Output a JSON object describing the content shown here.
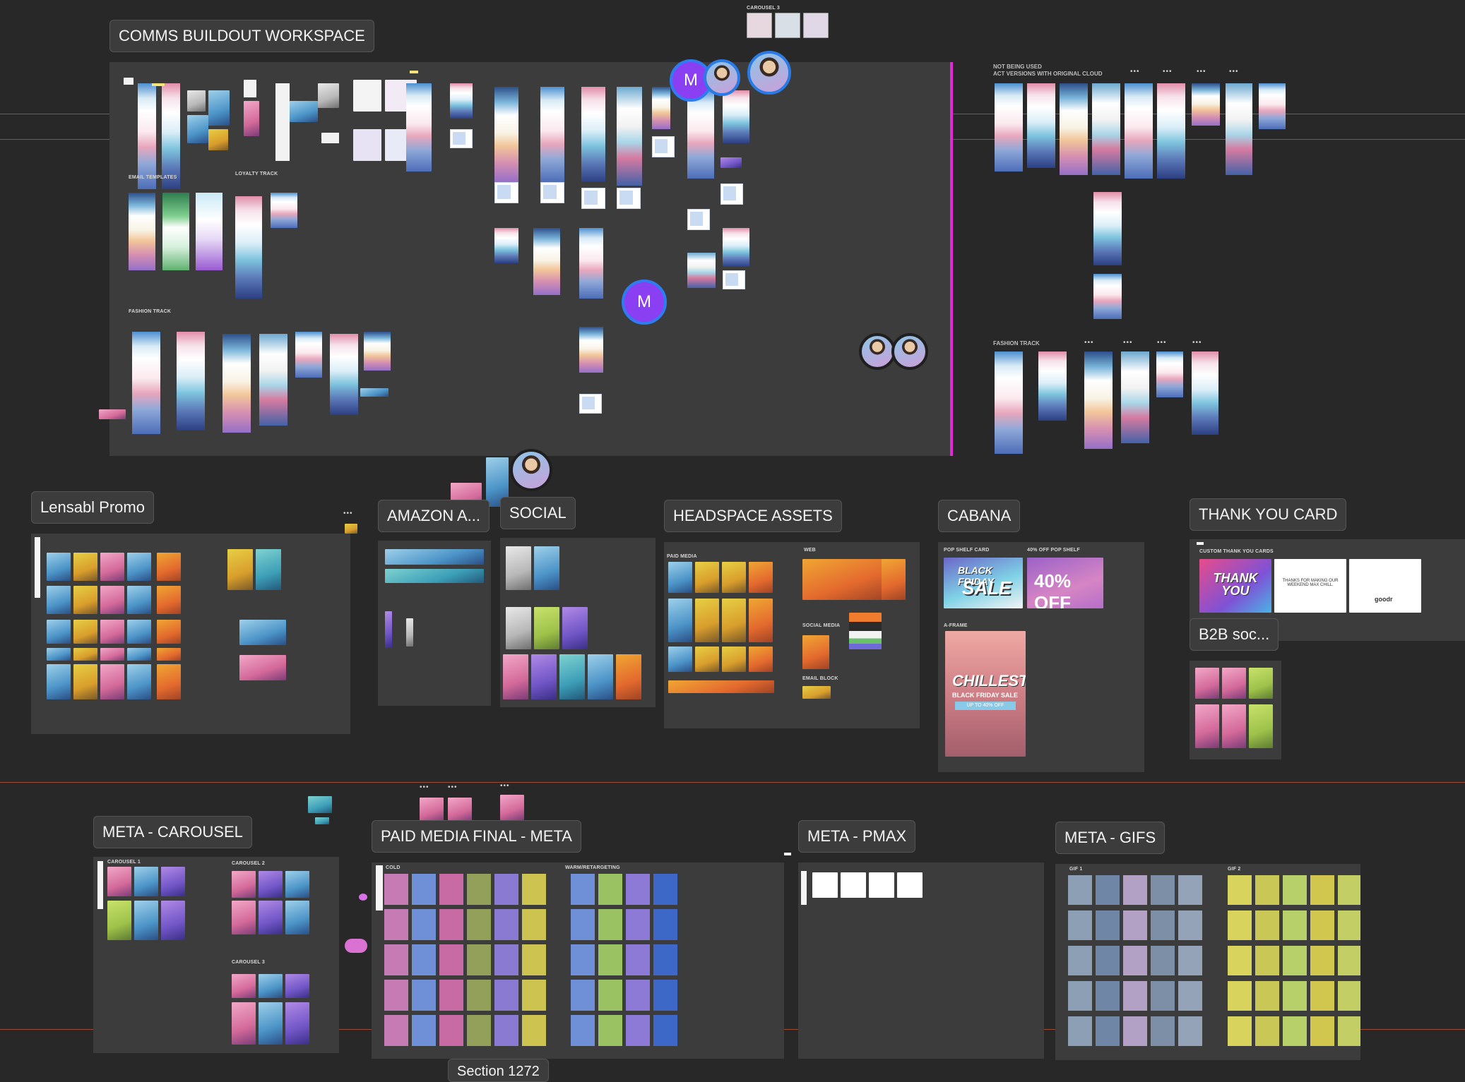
{
  "labels": {
    "comms": "COMMS BUILDOUT WORKSPACE",
    "lensabl": "Lensabl Promo",
    "amazon": "AMAZON A...",
    "social": "SOCIAL",
    "headspace": "HEADSPACE ASSETS",
    "cabana": "CABANA",
    "thankyou": "THANK YOU CARD",
    "b2b": "B2B soc...",
    "meta_carousel": "META - CAROUSEL",
    "paid_media": "PAID MEDIA FINAL - META",
    "meta_pmax": "META - PMAX",
    "meta_gifs": "META - GIFS",
    "section_partial": "Section 1272"
  },
  "comms": {
    "email_templates": "EMAIL TEMPLATES",
    "loyalty_track": "LOYALTY TRACK",
    "fashion_track": "FASHION TRACK"
  },
  "outside": {
    "carousel3": "CAROUSEL 3",
    "not_used_1": "NOT BEING USED",
    "not_used_2": "ACT VERSIONS WITH ORIGINAL CLOUD",
    "fashion_track": "FASHION TRACK"
  },
  "headspace": {
    "paid_media": "PAID MEDIA",
    "web": "WEB",
    "social_media": "SOCIAL MEDIA",
    "email_block": "EMAIL BLOCK"
  },
  "cabana": {
    "pop_shelf_card": "POP SHELF CARD",
    "pop_shelf": "40% OFF POP SHELF",
    "a_frame": "A-FRAME",
    "bf_line1": "BLACK FRIDAY",
    "bf_line2": "SALE",
    "forty_off": "40% OFF",
    "chillest": "CHILLEST",
    "bf_sale": "BLACK FRIDAY SALE",
    "up_to": "UP TO 40% OFF"
  },
  "thankyou": {
    "custom": "CUSTOM THANK YOU CARDS",
    "thank": "THANK YOU",
    "message": "THANKS FOR MAKING OUR WEEKEND MAX CHILL.",
    "brand": "goodr"
  },
  "meta_carousel": {
    "c1": "CAROUSEL 1",
    "c2": "CAROUSEL 2",
    "c3": "CAROUSEL 3"
  },
  "paid_media": {
    "cold": "COLD",
    "warm": "WARM/RETARGETING"
  },
  "meta_gifs": {
    "gif1": "GIF 1",
    "gif2": "GIF 2"
  },
  "avatars": {
    "m": "M"
  },
  "colors": {
    "canvas": "#282828",
    "frame": "#3c3c3c",
    "accent_magenta": "#e12ad6",
    "cursor_blue": "#2f7cf0",
    "avatar_purple": "#8b3ff2"
  }
}
